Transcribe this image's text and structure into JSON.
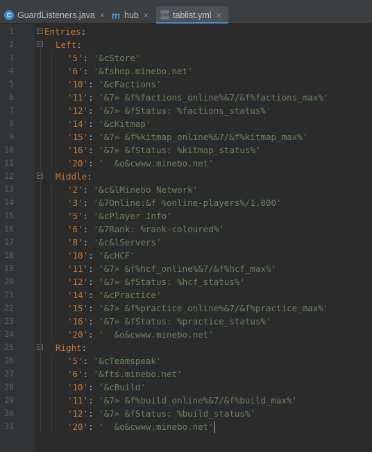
{
  "tabs": [
    {
      "label": "GuardListeners.java",
      "icon": "java-class-icon",
      "icon_glyph": "C",
      "active": false
    },
    {
      "label": "hub",
      "icon": "kotlin-module-icon",
      "icon_glyph": "m",
      "active": false
    },
    {
      "label": "tablist.yml",
      "icon": "yaml-file-icon",
      "icon_glyph": "yml",
      "active": true
    }
  ],
  "close_glyph": "×",
  "colors": {
    "key": "#cc7832",
    "string": "#6a8759",
    "background": "#2b2b2b",
    "gutter": "#313335",
    "line_number": "#606366",
    "active_tab_underline": "#4a88c7"
  },
  "editor": {
    "lines": [
      {
        "n": "1",
        "indent": 0,
        "key": "Entries",
        "value": "",
        "fold": true
      },
      {
        "n": "2",
        "indent": 1,
        "key": "Left",
        "value": "",
        "fold": true
      },
      {
        "n": "3",
        "indent": 2,
        "key": "'5'",
        "value": "'&cStore'"
      },
      {
        "n": "4",
        "indent": 2,
        "key": "'6'",
        "value": "'&fshop.minebo.net'"
      },
      {
        "n": "5",
        "indent": 2,
        "key": "'10'",
        "value": "'&cFactions'"
      },
      {
        "n": "6",
        "indent": 2,
        "key": "'11'",
        "value": "'&7» &f%factions_online%&7/&f%factions_max%'"
      },
      {
        "n": "7",
        "indent": 2,
        "key": "'12'",
        "value": "'&7» &fStatus: %factions_status%'"
      },
      {
        "n": "8",
        "indent": 2,
        "key": "'14'",
        "value": "'&cKitmap'"
      },
      {
        "n": "9",
        "indent": 2,
        "key": "'15'",
        "value": "'&7» &f%kitmap_online%&7/&f%kitmap_max%'"
      },
      {
        "n": "10",
        "indent": 2,
        "key": "'16'",
        "value": "'&7» &fStatus: %kitmap_status%'"
      },
      {
        "n": "11",
        "indent": 2,
        "key": "'20'",
        "value": "'  &o&cwww.minebo.net'"
      },
      {
        "n": "12",
        "indent": 1,
        "key": "Middle",
        "value": "",
        "fold": true
      },
      {
        "n": "13",
        "indent": 2,
        "key": "'2'",
        "value": "'&c&lMinebo Network'"
      },
      {
        "n": "14",
        "indent": 2,
        "key": "'3'",
        "value": "'&7Online:&f %online-players%/1,000'"
      },
      {
        "n": "15",
        "indent": 2,
        "key": "'5'",
        "value": "'&cPlayer Info'"
      },
      {
        "n": "16",
        "indent": 2,
        "key": "'6'",
        "value": "'&7Rank: %rank-coloured%'"
      },
      {
        "n": "17",
        "indent": 2,
        "key": "'8'",
        "value": "'&c&lServers'"
      },
      {
        "n": "18",
        "indent": 2,
        "key": "'10'",
        "value": "'&cHCF'"
      },
      {
        "n": "19",
        "indent": 2,
        "key": "'11'",
        "value": "'&7» &f%hcf_online%&7/&f%hcf_max%'"
      },
      {
        "n": "20",
        "indent": 2,
        "key": "'12'",
        "value": "'&7» &fStatus: %hcf_status%'"
      },
      {
        "n": "21",
        "indent": 2,
        "key": "'14'",
        "value": "'&cPractice'"
      },
      {
        "n": "22",
        "indent": 2,
        "key": "'15'",
        "value": "'&7» &f%practice_online%&7/&f%practice_max%'"
      },
      {
        "n": "23",
        "indent": 2,
        "key": "'16'",
        "value": "'&7» &fStatus: %practice_status%'"
      },
      {
        "n": "24",
        "indent": 2,
        "key": "'20'",
        "value": "'  &o&cwww.minebo.net'"
      },
      {
        "n": "25",
        "indent": 1,
        "key": "Right",
        "value": "",
        "fold": true
      },
      {
        "n": "26",
        "indent": 2,
        "key": "'5'",
        "value": "'&cTeamspeak'"
      },
      {
        "n": "27",
        "indent": 2,
        "key": "'6'",
        "value": "'&fts.minebo.net'"
      },
      {
        "n": "28",
        "indent": 2,
        "key": "'10'",
        "value": "'&cBuild'"
      },
      {
        "n": "29",
        "indent": 2,
        "key": "'11'",
        "value": "'&7» &f%build_online%&7/&f%build_max%'"
      },
      {
        "n": "30",
        "indent": 2,
        "key": "'12'",
        "value": "'&7» &fStatus: %build_status%'"
      },
      {
        "n": "31",
        "indent": 2,
        "key": "'20'",
        "value": "'  &o&cwww.minebo.net'",
        "cursor": true
      }
    ]
  }
}
